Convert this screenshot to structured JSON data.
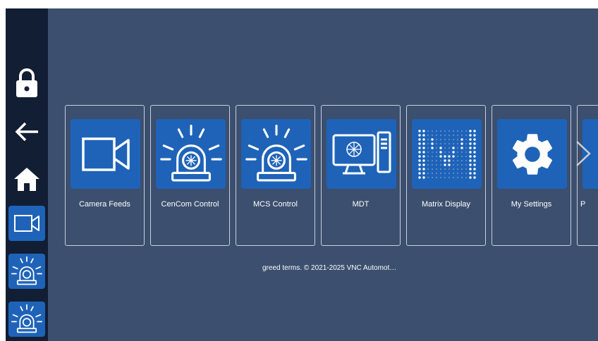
{
  "sidebar": {
    "items": [
      {
        "icon": "lock-icon"
      },
      {
        "icon": "back-arrow-icon"
      },
      {
        "icon": "home-icon"
      },
      {
        "icon": "camera-icon"
      },
      {
        "icon": "siren-icon"
      },
      {
        "icon": "siren-icon"
      }
    ]
  },
  "tiles": [
    {
      "label": "Camera Feeds",
      "icon": "camera-icon"
    },
    {
      "label": "CenCom Control",
      "icon": "siren-icon"
    },
    {
      "label": "MCS Control",
      "icon": "siren-icon"
    },
    {
      "label": "MDT",
      "icon": "computer-icon"
    },
    {
      "label": "Matrix Display",
      "icon": "matrix-display-icon"
    },
    {
      "label": "My Settings",
      "icon": "gear-icon"
    },
    {
      "label": "P",
      "icon": "unknown-icon"
    }
  ],
  "footer": {
    "text": "greed terms. © 2021-2025 VNC Automot…"
  },
  "colors": {
    "background": "#3c4f6e",
    "sidebar": "#121e34",
    "tile_blue": "#1e63b8",
    "card_border": "#c9cfd9"
  }
}
